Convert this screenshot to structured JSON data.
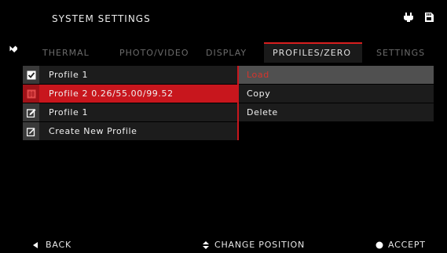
{
  "header": {
    "title": "SYSTEM SETTINGS",
    "icons": [
      "power-plug-icon",
      "sd-card-icon"
    ]
  },
  "nav": {
    "back_icon": "back-arrow-icon"
  },
  "tabs": [
    {
      "label": "THERMAL",
      "active": false
    },
    {
      "label": "PHOTO/VIDEO",
      "active": false
    },
    {
      "label": "DISPLAY",
      "active": false
    },
    {
      "label": "PROFILES/ZERO",
      "active": true
    },
    {
      "label": "SETTINGS",
      "active": false
    }
  ],
  "profiles": [
    {
      "label": "Profile 1",
      "icon": "checkbox-checked-icon",
      "selected": false
    },
    {
      "label": "Profile 2 0.26/55.00/99.52",
      "icon": "reticle-grid-icon",
      "selected": true
    },
    {
      "label": "Profile 1",
      "icon": "edit-icon",
      "selected": false
    },
    {
      "label": "Create New Profile",
      "icon": "edit-new-icon",
      "selected": false
    }
  ],
  "context_menu": [
    {
      "label": "Load",
      "highlighted": true
    },
    {
      "label": "Copy",
      "highlighted": false
    },
    {
      "label": "Delete",
      "highlighted": false
    }
  ],
  "footer": {
    "back": "BACK",
    "change_position": "CHANGE POSITION",
    "accept": "ACCEPT"
  },
  "colors": {
    "accent": "#c8161d",
    "highlight": "#505050",
    "highlight_text": "#d6342c",
    "inactive_tab": "#6b6b6b"
  }
}
